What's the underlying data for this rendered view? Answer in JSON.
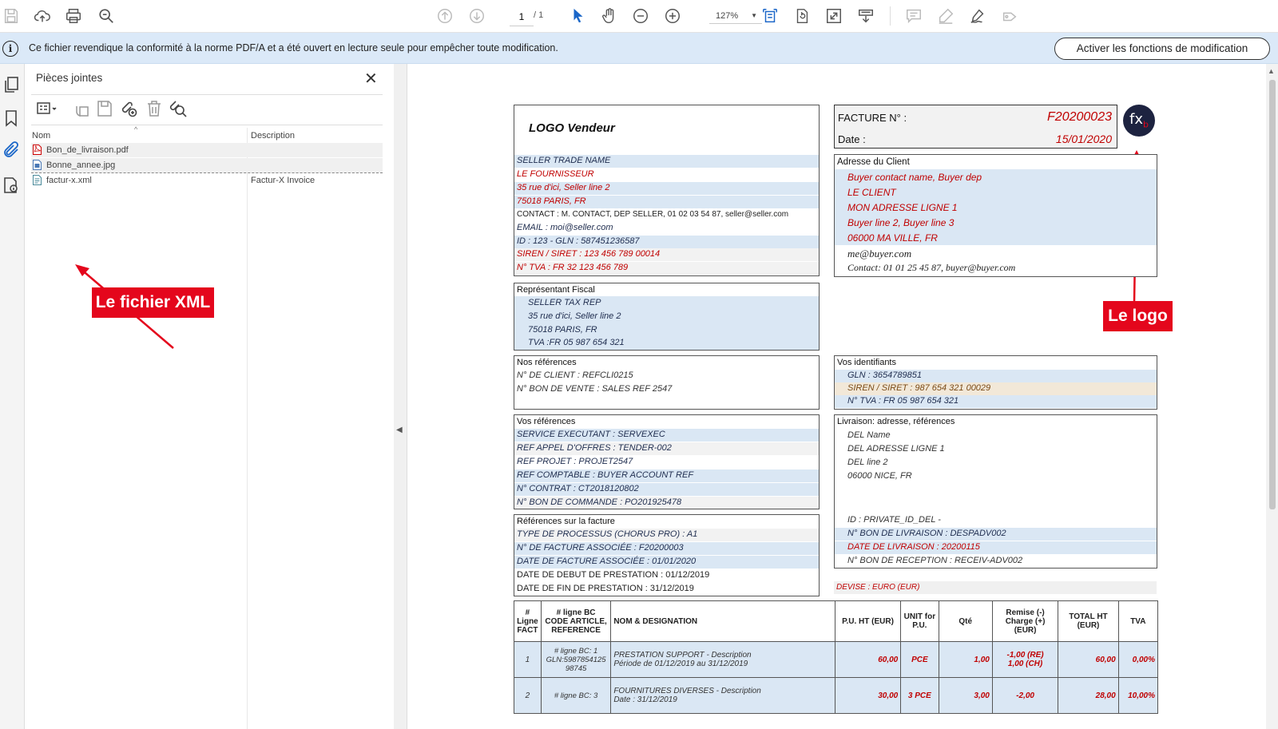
{
  "toolbar": {
    "page_current": "1",
    "page_total": "/  1",
    "zoom": "127%",
    "icons": [
      "save-icon",
      "upload-icon",
      "print-icon",
      "search-icon",
      "page-up-icon",
      "page-down-icon",
      "select-cursor-icon",
      "hand-icon",
      "zoom-out-icon",
      "zoom-in-icon",
      "fit-page-icon",
      "rotate-icon",
      "fullscreen-icon",
      "read-mode-icon",
      "comment-icon",
      "highlight-icon",
      "sign-icon",
      "stamp-icon"
    ]
  },
  "notification": {
    "text": "Ce fichier revendique la conformité à la norme PDF/A et a été ouvert en lecture seule pour empêcher toute modification.",
    "button": "Activer les fonctions de modification",
    "icon": "info-icon"
  },
  "panel": {
    "title": "Pièces jointes",
    "columns": {
      "name": "Nom",
      "description": "Description"
    },
    "files": [
      {
        "name": "Bon_de_livraison.pdf",
        "description": "",
        "icon": "pdf-file-icon"
      },
      {
        "name": "Bonne_annee.jpg",
        "description": "",
        "icon": "image-file-icon"
      },
      {
        "name": "factur-x.xml",
        "description": "Factur-X Invoice",
        "icon": "xml-file-icon"
      }
    ]
  },
  "callouts": {
    "xml": "Le fichier XML",
    "logo": "Le logo"
  },
  "invoice": {
    "logo_vendeur": "LOGO Vendeur",
    "seller": {
      "trade_name": "SELLER TRADE NAME",
      "name": "LE FOURNISSEUR",
      "address1": "35 rue d'ici, Seller line 2",
      "city": "75018 PARIS, FR",
      "contact": "CONTACT : M. CONTACT, DEP SELLER, 01 02 03 54 87, seller@seller.com",
      "email": "EMAIL : moi@seller.com",
      "id": "ID : 123 - GLN : 587451236587",
      "siren": "SIREN / SIRET : 123 456 789 00014",
      "tva": "N° TVA : FR 32 123 456 789"
    },
    "facture": {
      "label_num": "FACTURE N° :",
      "num": "F20200023",
      "label_date": "Date :",
      "date": "15/01/2020"
    },
    "logo_badge": "fx",
    "logo_badge_sub": "b",
    "client": {
      "title": "Adresse du Client",
      "contact": "Buyer contact name, Buyer dep",
      "name": "LE CLIENT",
      "line1": "MON ADRESSE LIGNE 1",
      "line2": "Buyer line 2, Buyer line 3",
      "city": "06000 MA VILLE, FR",
      "email": "me@buyer.com",
      "contact2": "Contact: 01 01 25 45 87, buyer@buyer.com"
    },
    "fiscal": {
      "title": "Représentant Fiscal",
      "name": "SELLER TAX REP",
      "address": "35 rue d'ici, Seller line 2",
      "city": "75018 PARIS, FR",
      "tva": "TVA :FR 05 987 654 321"
    },
    "nos_refs": {
      "title": "Nos références",
      "client": "N° DE CLIENT : REFCLI0215",
      "vente": "N° BON DE VENTE : SALES REF 2547"
    },
    "vos_ids": {
      "title": "Vos identifiants",
      "gln": "GLN : 3654789851",
      "siren": "SIREN / SIRET : 987 654 321 00029",
      "tva": "N° TVA : FR 05 987 654 321"
    },
    "vos_refs": {
      "title": "Vos références",
      "l1": "SERVICE EXECUTANT : SERVEXEC",
      "l2": "REF APPEL D'OFFRES : TENDER-002",
      "l3": "REF PROJET : PROJET2547",
      "l4": "REF COMPTABLE : BUYER ACCOUNT REF",
      "l5": "N° CONTRAT : CT2018120802",
      "l6": "N° BON DE COMMANDE : PO201925478"
    },
    "livraison": {
      "title": "Livraison: adresse, références",
      "l1": "DEL Name",
      "l2": "DEL ADRESSE LIGNE 1",
      "l3": "DEL line 2",
      "l4": "06000 NICE, FR",
      "l5": "ID : PRIVATE_ID_DEL -",
      "l6": "N° BON DE LIVRAISON : DESPADV002",
      "l7": "DATE DE LIVRAISON : 20200115",
      "l8": "N° BON DE RECEPTION : RECEIV-ADV002"
    },
    "refs_facture": {
      "title": "Références sur la facture",
      "l1": "TYPE DE PROCESSUS (CHORUS PRO) : A1",
      "l2": "N° DE FACTURE ASSOCIÉE : F20200003",
      "l3": "DATE DE FACTURE ASSOCIÉE : 01/01/2020",
      "l4": "DATE DE DEBUT DE PRESTATION : 01/12/2019",
      "l5": "DATE DE FIN DE PRESTATION : 31/12/2019"
    },
    "devise": "DEVISE : EURO (EUR)",
    "table": {
      "headers": {
        "ligne": "# Ligne FACT",
        "ref": "# ligne BC CODE ARTICLE, REFERENCE",
        "nom": "NOM & DESIGNATION",
        "pu": "P.U. HT (EUR)",
        "unit": "UNIT for P.U.",
        "qte": "Qté",
        "remise": "Remise (-) Charge (+) (EUR)",
        "total": "TOTAL HT (EUR)",
        "tva": "TVA"
      },
      "rows": [
        {
          "ligne": "1",
          "ref": "# ligne BC: 1 GLN:5987854125 98745",
          "nom": "PRESTATION SUPPORT - Description",
          "nom2": "Période de 01/12/2019 au 31/12/2019",
          "pu": "60,00",
          "unit": "PCE",
          "qte": "1,00",
          "remise": "-1,00 (RE)",
          "remise2": "1,00 (CH)",
          "total": "60,00",
          "tva": "0,00%"
        },
        {
          "ligne": "2",
          "ref": "# ligne BC: 3",
          "nom": "FOURNITURES DIVERSES - Description",
          "nom2": "Date : 31/12/2019",
          "pu": "30,00",
          "unit": "3 PCE",
          "qte": "3,00",
          "remise": "-2,00",
          "remise2": "",
          "total": "28,00",
          "tva": "10,00%"
        }
      ]
    }
  }
}
